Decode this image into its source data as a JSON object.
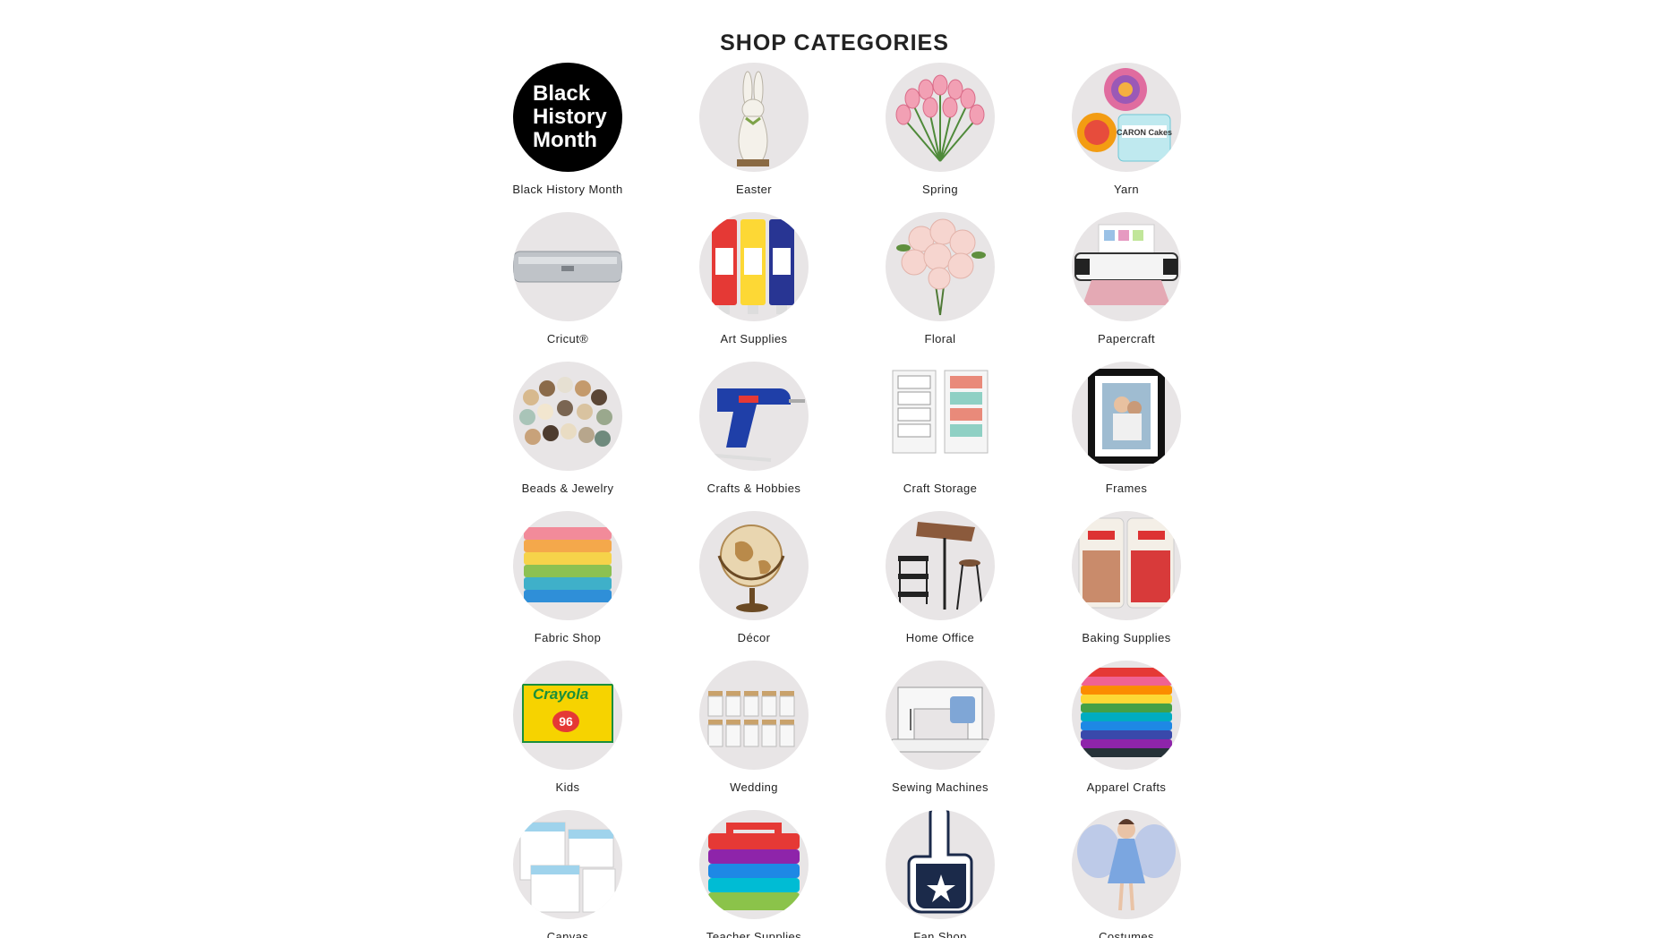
{
  "heading": "SHOP CATEGORIES",
  "colors": {
    "circle_bg": "#e8e5e6",
    "text": "#222222"
  },
  "categories": [
    {
      "label": "Black History Month",
      "icon": "black-history-month-badge",
      "badge_lines": [
        "Black",
        "History",
        "Month"
      ]
    },
    {
      "label": "Easter",
      "icon": "bunny-figure-icon"
    },
    {
      "label": "Spring",
      "icon": "tulips-icon"
    },
    {
      "label": "Yarn",
      "icon": "yarn-cakes-icon",
      "brand_text": "CARON Cakes"
    },
    {
      "label": "Cricut®",
      "icon": "cutting-machine-icon"
    },
    {
      "label": "Art Supplies",
      "icon": "paint-tubes-icon"
    },
    {
      "label": "Floral",
      "icon": "rose-bouquet-icon"
    },
    {
      "label": "Papercraft",
      "icon": "paper-cutter-machine-icon"
    },
    {
      "label": "Beads & Jewelry",
      "icon": "beaded-bracelets-icon"
    },
    {
      "label": "Crafts & Hobbies",
      "icon": "glue-gun-icon"
    },
    {
      "label": "Craft Storage",
      "icon": "storage-carts-icon"
    },
    {
      "label": "Frames",
      "icon": "photo-frame-icon"
    },
    {
      "label": "Fabric Shop",
      "icon": "fabric-stack-icon"
    },
    {
      "label": "Décor",
      "icon": "globe-icon"
    },
    {
      "label": "Home Office",
      "icon": "desk-and-stool-icon"
    },
    {
      "label": "Baking Supplies",
      "icon": "candy-bags-icon"
    },
    {
      "label": "Kids",
      "icon": "crayon-box-icon",
      "brand_text": "Crayola",
      "count_text": "96"
    },
    {
      "label": "Wedding",
      "icon": "glass-jars-icon"
    },
    {
      "label": "Sewing Machines",
      "icon": "sewing-machine-icon"
    },
    {
      "label": "Apparel Crafts",
      "icon": "folded-shirts-icon"
    },
    {
      "label": "Canvas",
      "icon": "canvas-panels-icon"
    },
    {
      "label": "Teacher Supplies",
      "icon": "caddy-bins-icon"
    },
    {
      "label": "Fan Shop",
      "icon": "foam-finger-icon"
    },
    {
      "label": "Costumes",
      "icon": "fairy-costume-icon"
    }
  ]
}
